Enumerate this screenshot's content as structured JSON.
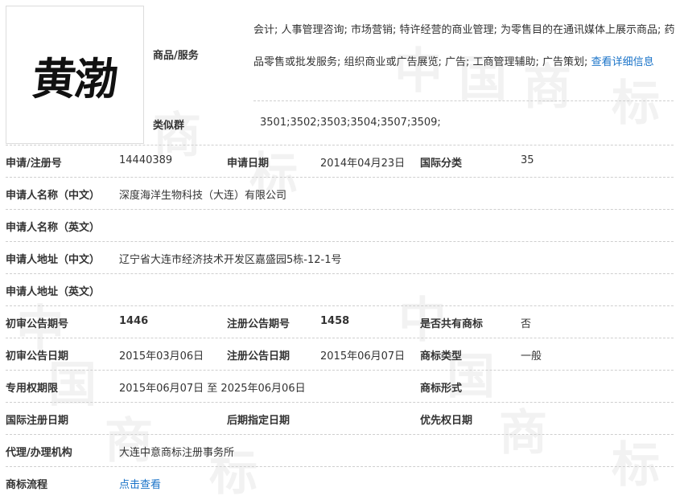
{
  "logo": {
    "text": "黄渤"
  },
  "goods": {
    "label": "商品/服务",
    "text": "会计; 人事管理咨询; 市场营销; 特许经营的商业管理; 为零售目的在通讯媒体上展示商品; 药品零售或批发服务; 组织商业或广告展览; 广告; 工商管理辅助; 广告策划;",
    "more_link": "查看详细信息"
  },
  "similar_group": {
    "label": "类似群",
    "value": "3501;3502;3503;3504;3507;3509;"
  },
  "rows": {
    "reg_no": {
      "label": "申请/注册号",
      "value": "14440389"
    },
    "apply_date": {
      "label": "申请日期",
      "value": "2014年04月23日"
    },
    "intl_class": {
      "label": "国际分类",
      "value": "35"
    },
    "applicant_cn": {
      "label": "申请人名称（中文）",
      "value": "深度海洋生物科技（大连）有限公司"
    },
    "applicant_en": {
      "label": "申请人名称（英文）",
      "value": ""
    },
    "address_cn": {
      "label": "申请人地址（中文）",
      "value": "辽宁省大连市经济技术开发区嘉盛园5栋-12-1号"
    },
    "address_en": {
      "label": "申请人地址（英文）",
      "value": ""
    },
    "prelim_issue": {
      "label": "初审公告期号",
      "value": "1446"
    },
    "reg_issue": {
      "label": "注册公告期号",
      "value": "1458"
    },
    "shared": {
      "label": "是否共有商标",
      "value": "否"
    },
    "prelim_date": {
      "label": "初审公告日期",
      "value": "2015年03月06日"
    },
    "reg_date": {
      "label": "注册公告日期",
      "value": "2015年06月07日"
    },
    "mark_type": {
      "label": "商标类型",
      "value": "一般"
    },
    "exclusive_period": {
      "label": "专用权期限",
      "value": "2015年06月07日 至 2025年06月06日"
    },
    "mark_form": {
      "label": "商标形式",
      "value": ""
    },
    "intl_reg_date": {
      "label": "国际注册日期",
      "value": ""
    },
    "later_designation": {
      "label": "后期指定日期",
      "value": ""
    },
    "priority_date": {
      "label": "优先权日期",
      "value": ""
    },
    "agent": {
      "label": "代理/办理机构",
      "value": "大连中意商标注册事务所"
    },
    "process": {
      "label": "商标流程",
      "value": "点击查看"
    }
  },
  "watermark": {
    "chars": [
      "中",
      "国",
      "商",
      "标"
    ]
  }
}
